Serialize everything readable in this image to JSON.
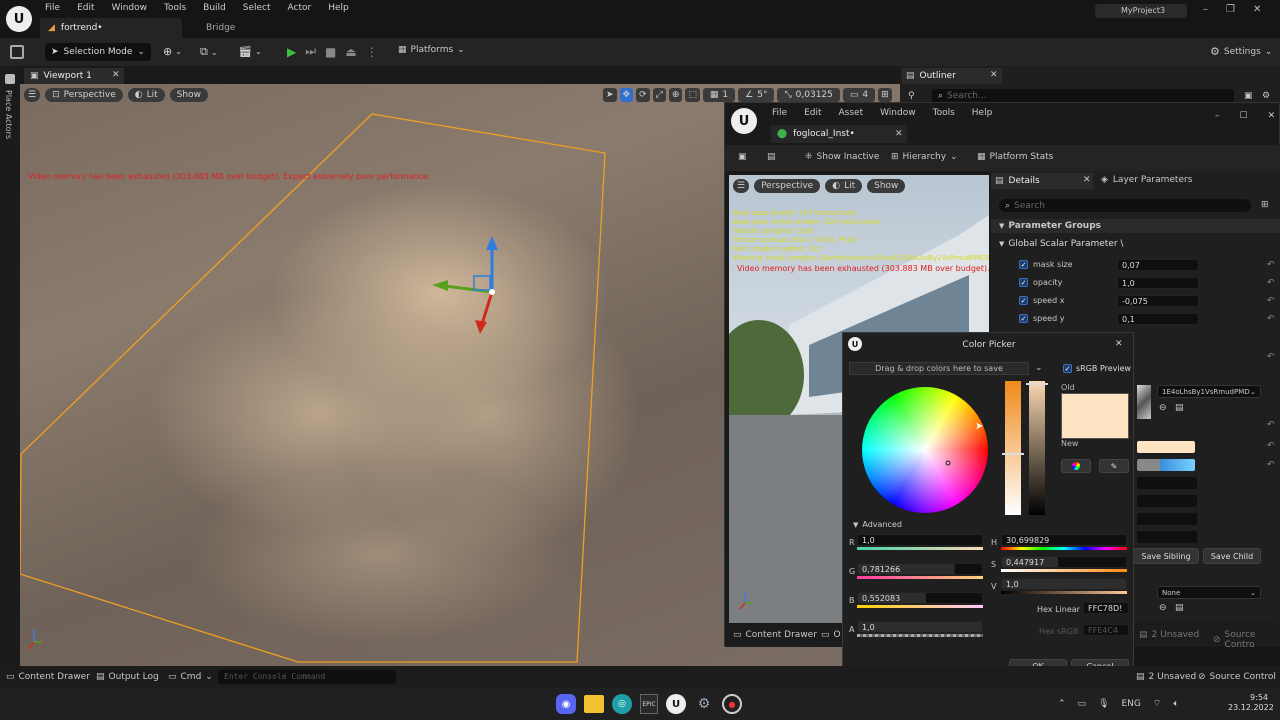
{
  "app": {
    "menu": [
      "File",
      "Edit",
      "Window",
      "Tools",
      "Build",
      "Select",
      "Actor",
      "Help"
    ],
    "project": "MyProject3",
    "tabs": [
      "fortrend•",
      "Bridge"
    ]
  },
  "toolbar": {
    "selection_mode": "Selection Mode",
    "platforms": "Platforms",
    "settings": "Settings"
  },
  "side_tab": "Place Actors",
  "viewport": {
    "tab": "Viewport 1",
    "perspective": "Perspective",
    "lit": "Lit",
    "show": "Show",
    "warning": "Video memory has been exhausted (303.883 MB over budget). Expect extremely poor performance.",
    "grid_size": "1",
    "rot_snap": "5°",
    "scale_snap": "0,03125",
    "cam_speed": "4"
  },
  "outliner": {
    "tab": "Outliner",
    "search_placeholder": "Search..."
  },
  "material_editor": {
    "menu": [
      "File",
      "Edit",
      "Asset",
      "Window",
      "Tools",
      "Help"
    ],
    "tab": "foglocal_Inst•",
    "toolbar": {
      "show_inactive": "Show Inactive",
      "hierarchy": "Hierarchy",
      "platform_stats": "Platform Stats"
    },
    "preview": {
      "perspective": "Perspective",
      "lit": "Lit",
      "show": "Show",
      "stats": [
        "Base pass shader: 157 instructions",
        "Base pass vertex shader: 229 instructions",
        "Texture samplers: 3/16",
        "Texture Lookups (Est.): VS(0), PS(4)",
        "Num shaders added: 122",
        "Warning: mask samples /Game/textures/Ghost/1E4oLhsBy1VsRmudPMDED ..."
      ],
      "warning": "Video memory has been exhausted (303.883 MB over budget). Expect ..."
    },
    "details_tab": "Details",
    "layer_tab": "Layer Parameters",
    "search_placeholder": "Search",
    "parameter_groups": "Parameter Groups",
    "global_scalar": "Global Scalar Parameter \\",
    "params": [
      {
        "name": "mask size",
        "value": "0,07"
      },
      {
        "name": "opacity",
        "value": "1,0"
      },
      {
        "name": "speed x",
        "value": "-0,075"
      },
      {
        "name": "speed y",
        "value": "0,1"
      }
    ],
    "texture_name": "1E4oLhsBy1VsRmudPMDED",
    "save_sibling": "Save Sibling",
    "save_child": "Save Child",
    "none_dropdown": "None",
    "content_drawer": "Content Drawer",
    "content_drawer_trunc": "O",
    "unsaved": "2 Unsaved",
    "source_control": "Source Contro"
  },
  "color_picker": {
    "title": "Color Picker",
    "drag_drop": "Drag & drop colors here to save",
    "srgb_preview": "sRGB Preview",
    "old_label": "Old",
    "new_label": "New",
    "old_color": "#FFE4C4",
    "advanced": "Advanced",
    "r_label": "R",
    "r": "1,0",
    "g_label": "G",
    "g": "0,781266",
    "b_label": "B",
    "b": "0,552083",
    "a_label": "A",
    "a": "1,0",
    "h_label": "H",
    "h": "30,699829",
    "s_label": "S",
    "s": "0,447917",
    "v_label": "V",
    "v": "1,0",
    "hex_linear_label": "Hex Linear",
    "hex_linear": "FFC78D!",
    "hex_srgb_label": "Hex sRGB",
    "hex_srgb": "FFE4C4",
    "ok": "OK",
    "cancel": "Cancel"
  },
  "statusbar": {
    "content_drawer": "Content Drawer",
    "output_log": "Output Log",
    "cmd": "Cmd",
    "console_placeholder": "Enter Console Command",
    "unsaved": "2 Unsaved",
    "source_control": "Source Control"
  },
  "taskbar": {
    "lang": "ENG",
    "time": "9:54",
    "date": "23.12.2022"
  }
}
